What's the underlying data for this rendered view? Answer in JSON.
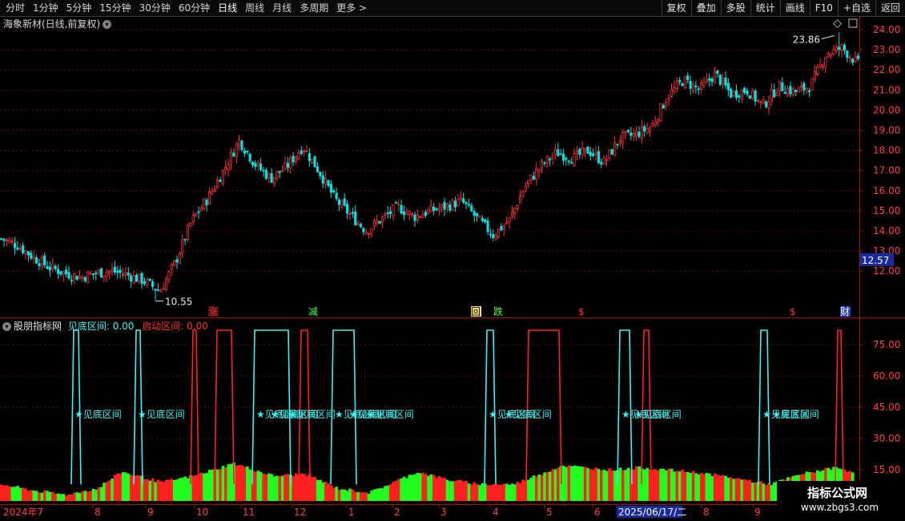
{
  "toolbar": {
    "periods": [
      "分时",
      "1分钟",
      "5分钟",
      "15分钟",
      "30分钟",
      "60分钟",
      "日线",
      "周线",
      "月线",
      "多周期",
      "更多 >"
    ],
    "active_period": "日线",
    "actions": [
      "复权",
      "叠加",
      "多股",
      "统计",
      "画线",
      "F10",
      "+自选",
      "返回"
    ]
  },
  "main": {
    "title": "海象新材(日线,前复权)",
    "high_label": "23.86",
    "low_label": "10.55",
    "price_badge": "12.57",
    "price_axis": [
      "24.00",
      "23.00",
      "22.00",
      "21.00",
      "20.00",
      "19.00",
      "18.00",
      "17.00",
      "16.00",
      "15.00",
      "14.00",
      "13.00",
      "12.00"
    ],
    "markers": [
      {
        "text": "涨",
        "color": "#ff3030",
        "bg": "#3a1010"
      },
      {
        "text": "减",
        "color": "#40ff40",
        "bg": ""
      },
      {
        "text": "回",
        "color": "#000000",
        "bg": "#ffe070"
      },
      {
        "text": "跌",
        "color": "#40ff40",
        "bg": ""
      },
      {
        "text": "$",
        "color": "#ff3030",
        "bg": ""
      },
      {
        "text": "$",
        "color": "#ff3030",
        "bg": ""
      },
      {
        "text": "财",
        "color": "#ffffff",
        "bg": "#2040c0"
      }
    ]
  },
  "indicator": {
    "name": "股朋指标网",
    "l1": "见底区间",
    "v1": "0.00",
    "l2": "启动区间",
    "v2": "0.00",
    "zone_text": "★见底区间",
    "axis": [
      "75.00",
      "60.00",
      "45.00",
      "30.00",
      "15.00"
    ]
  },
  "xaxis": {
    "labels": [
      "2024年7",
      "8",
      "9",
      "10",
      "11",
      "12",
      "1",
      "2",
      "3",
      "4",
      "5",
      "6",
      "2025/06/17/二",
      "8",
      "9"
    ]
  },
  "watermark": {
    "line1": "指标公式网",
    "line2": "www.zbgs3.com"
  },
  "colors": {
    "up": "#ff3030",
    "down": "#00e0e0",
    "cyan": "#40f0f0",
    "red": "#ff2020",
    "green": "#20ff20",
    "axis": "#a01010"
  },
  "chart_data": {
    "type": "candlestick",
    "ylim": [
      10.0,
      24.3
    ],
    "close_path": [
      13.6,
      13.3,
      12.7,
      12.2,
      11.9,
      11.7,
      11.9,
      12.0,
      11.8,
      11.5,
      11.0,
      12.5,
      14.5,
      15.6,
      17.0,
      18.5,
      17.3,
      16.6,
      17.2,
      18.2,
      17.0,
      15.6,
      14.8,
      14.0,
      14.6,
      15.2,
      14.7,
      15.0,
      15.2,
      15.5,
      14.6,
      13.8,
      14.5,
      16.2,
      17.2,
      17.9,
      17.6,
      18.0,
      17.4,
      18.6,
      18.8,
      19.2,
      20.7,
      21.5,
      21.0,
      21.8,
      20.8,
      21.0,
      20.2,
      21.2,
      20.9,
      21.2,
      22.8,
      23.1,
      22.3
    ],
    "high": 23.86,
    "low": 10.55,
    "last": 12.57
  }
}
